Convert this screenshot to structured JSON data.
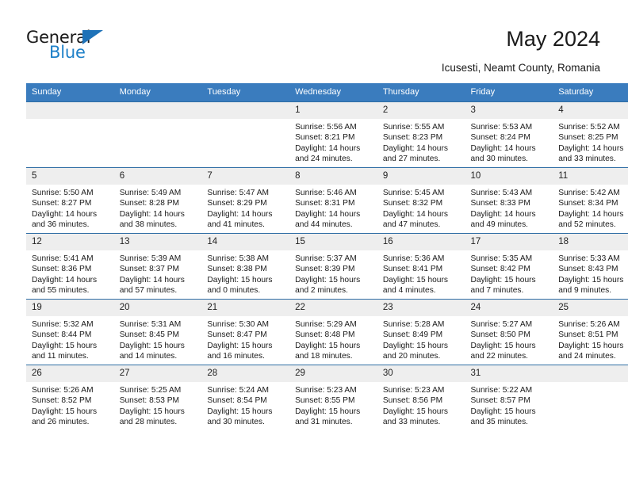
{
  "brand": {
    "name_top": "General",
    "name_bottom": "Blue",
    "accent_color": "#1e80c8",
    "triangle_color": "#1e72b8"
  },
  "header": {
    "title": "May 2024",
    "subtitle": "Icusesti, Neamt County, Romania"
  },
  "theme": {
    "header_row_bg": "#3a7cbe",
    "daynum_bg": "#eeeeee",
    "cell_border": "#2e6da4"
  },
  "weekdays": [
    "Sunday",
    "Monday",
    "Tuesday",
    "Wednesday",
    "Thursday",
    "Friday",
    "Saturday"
  ],
  "labels": {
    "sunrise_prefix": "Sunrise: ",
    "sunset_prefix": "Sunset: ",
    "daylight_prefix": "Daylight: "
  },
  "weeks": [
    [
      {
        "day": "",
        "sunrise": "",
        "sunset": "",
        "daylight_line1": "",
        "daylight_line2": ""
      },
      {
        "day": "",
        "sunrise": "",
        "sunset": "",
        "daylight_line1": "",
        "daylight_line2": ""
      },
      {
        "day": "",
        "sunrise": "",
        "sunset": "",
        "daylight_line1": "",
        "daylight_line2": ""
      },
      {
        "day": "1",
        "sunrise": "Sunrise: 5:56 AM",
        "sunset": "Sunset: 8:21 PM",
        "daylight_line1": "Daylight: 14 hours",
        "daylight_line2": "and 24 minutes."
      },
      {
        "day": "2",
        "sunrise": "Sunrise: 5:55 AM",
        "sunset": "Sunset: 8:23 PM",
        "daylight_line1": "Daylight: 14 hours",
        "daylight_line2": "and 27 minutes."
      },
      {
        "day": "3",
        "sunrise": "Sunrise: 5:53 AM",
        "sunset": "Sunset: 8:24 PM",
        "daylight_line1": "Daylight: 14 hours",
        "daylight_line2": "and 30 minutes."
      },
      {
        "day": "4",
        "sunrise": "Sunrise: 5:52 AM",
        "sunset": "Sunset: 8:25 PM",
        "daylight_line1": "Daylight: 14 hours",
        "daylight_line2": "and 33 minutes."
      }
    ],
    [
      {
        "day": "5",
        "sunrise": "Sunrise: 5:50 AM",
        "sunset": "Sunset: 8:27 PM",
        "daylight_line1": "Daylight: 14 hours",
        "daylight_line2": "and 36 minutes."
      },
      {
        "day": "6",
        "sunrise": "Sunrise: 5:49 AM",
        "sunset": "Sunset: 8:28 PM",
        "daylight_line1": "Daylight: 14 hours",
        "daylight_line2": "and 38 minutes."
      },
      {
        "day": "7",
        "sunrise": "Sunrise: 5:47 AM",
        "sunset": "Sunset: 8:29 PM",
        "daylight_line1": "Daylight: 14 hours",
        "daylight_line2": "and 41 minutes."
      },
      {
        "day": "8",
        "sunrise": "Sunrise: 5:46 AM",
        "sunset": "Sunset: 8:31 PM",
        "daylight_line1": "Daylight: 14 hours",
        "daylight_line2": "and 44 minutes."
      },
      {
        "day": "9",
        "sunrise": "Sunrise: 5:45 AM",
        "sunset": "Sunset: 8:32 PM",
        "daylight_line1": "Daylight: 14 hours",
        "daylight_line2": "and 47 minutes."
      },
      {
        "day": "10",
        "sunrise": "Sunrise: 5:43 AM",
        "sunset": "Sunset: 8:33 PM",
        "daylight_line1": "Daylight: 14 hours",
        "daylight_line2": "and 49 minutes."
      },
      {
        "day": "11",
        "sunrise": "Sunrise: 5:42 AM",
        "sunset": "Sunset: 8:34 PM",
        "daylight_line1": "Daylight: 14 hours",
        "daylight_line2": "and 52 minutes."
      }
    ],
    [
      {
        "day": "12",
        "sunrise": "Sunrise: 5:41 AM",
        "sunset": "Sunset: 8:36 PM",
        "daylight_line1": "Daylight: 14 hours",
        "daylight_line2": "and 55 minutes."
      },
      {
        "day": "13",
        "sunrise": "Sunrise: 5:39 AM",
        "sunset": "Sunset: 8:37 PM",
        "daylight_line1": "Daylight: 14 hours",
        "daylight_line2": "and 57 minutes."
      },
      {
        "day": "14",
        "sunrise": "Sunrise: 5:38 AM",
        "sunset": "Sunset: 8:38 PM",
        "daylight_line1": "Daylight: 15 hours",
        "daylight_line2": "and 0 minutes."
      },
      {
        "day": "15",
        "sunrise": "Sunrise: 5:37 AM",
        "sunset": "Sunset: 8:39 PM",
        "daylight_line1": "Daylight: 15 hours",
        "daylight_line2": "and 2 minutes."
      },
      {
        "day": "16",
        "sunrise": "Sunrise: 5:36 AM",
        "sunset": "Sunset: 8:41 PM",
        "daylight_line1": "Daylight: 15 hours",
        "daylight_line2": "and 4 minutes."
      },
      {
        "day": "17",
        "sunrise": "Sunrise: 5:35 AM",
        "sunset": "Sunset: 8:42 PM",
        "daylight_line1": "Daylight: 15 hours",
        "daylight_line2": "and 7 minutes."
      },
      {
        "day": "18",
        "sunrise": "Sunrise: 5:33 AM",
        "sunset": "Sunset: 8:43 PM",
        "daylight_line1": "Daylight: 15 hours",
        "daylight_line2": "and 9 minutes."
      }
    ],
    [
      {
        "day": "19",
        "sunrise": "Sunrise: 5:32 AM",
        "sunset": "Sunset: 8:44 PM",
        "daylight_line1": "Daylight: 15 hours",
        "daylight_line2": "and 11 minutes."
      },
      {
        "day": "20",
        "sunrise": "Sunrise: 5:31 AM",
        "sunset": "Sunset: 8:45 PM",
        "daylight_line1": "Daylight: 15 hours",
        "daylight_line2": "and 14 minutes."
      },
      {
        "day": "21",
        "sunrise": "Sunrise: 5:30 AM",
        "sunset": "Sunset: 8:47 PM",
        "daylight_line1": "Daylight: 15 hours",
        "daylight_line2": "and 16 minutes."
      },
      {
        "day": "22",
        "sunrise": "Sunrise: 5:29 AM",
        "sunset": "Sunset: 8:48 PM",
        "daylight_line1": "Daylight: 15 hours",
        "daylight_line2": "and 18 minutes."
      },
      {
        "day": "23",
        "sunrise": "Sunrise: 5:28 AM",
        "sunset": "Sunset: 8:49 PM",
        "daylight_line1": "Daylight: 15 hours",
        "daylight_line2": "and 20 minutes."
      },
      {
        "day": "24",
        "sunrise": "Sunrise: 5:27 AM",
        "sunset": "Sunset: 8:50 PM",
        "daylight_line1": "Daylight: 15 hours",
        "daylight_line2": "and 22 minutes."
      },
      {
        "day": "25",
        "sunrise": "Sunrise: 5:26 AM",
        "sunset": "Sunset: 8:51 PM",
        "daylight_line1": "Daylight: 15 hours",
        "daylight_line2": "and 24 minutes."
      }
    ],
    [
      {
        "day": "26",
        "sunrise": "Sunrise: 5:26 AM",
        "sunset": "Sunset: 8:52 PM",
        "daylight_line1": "Daylight: 15 hours",
        "daylight_line2": "and 26 minutes."
      },
      {
        "day": "27",
        "sunrise": "Sunrise: 5:25 AM",
        "sunset": "Sunset: 8:53 PM",
        "daylight_line1": "Daylight: 15 hours",
        "daylight_line2": "and 28 minutes."
      },
      {
        "day": "28",
        "sunrise": "Sunrise: 5:24 AM",
        "sunset": "Sunset: 8:54 PM",
        "daylight_line1": "Daylight: 15 hours",
        "daylight_line2": "and 30 minutes."
      },
      {
        "day": "29",
        "sunrise": "Sunrise: 5:23 AM",
        "sunset": "Sunset: 8:55 PM",
        "daylight_line1": "Daylight: 15 hours",
        "daylight_line2": "and 31 minutes."
      },
      {
        "day": "30",
        "sunrise": "Sunrise: 5:23 AM",
        "sunset": "Sunset: 8:56 PM",
        "daylight_line1": "Daylight: 15 hours",
        "daylight_line2": "and 33 minutes."
      },
      {
        "day": "31",
        "sunrise": "Sunrise: 5:22 AM",
        "sunset": "Sunset: 8:57 PM",
        "daylight_line1": "Daylight: 15 hours",
        "daylight_line2": "and 35 minutes."
      },
      {
        "day": "",
        "sunrise": "",
        "sunset": "",
        "daylight_line1": "",
        "daylight_line2": ""
      }
    ]
  ]
}
